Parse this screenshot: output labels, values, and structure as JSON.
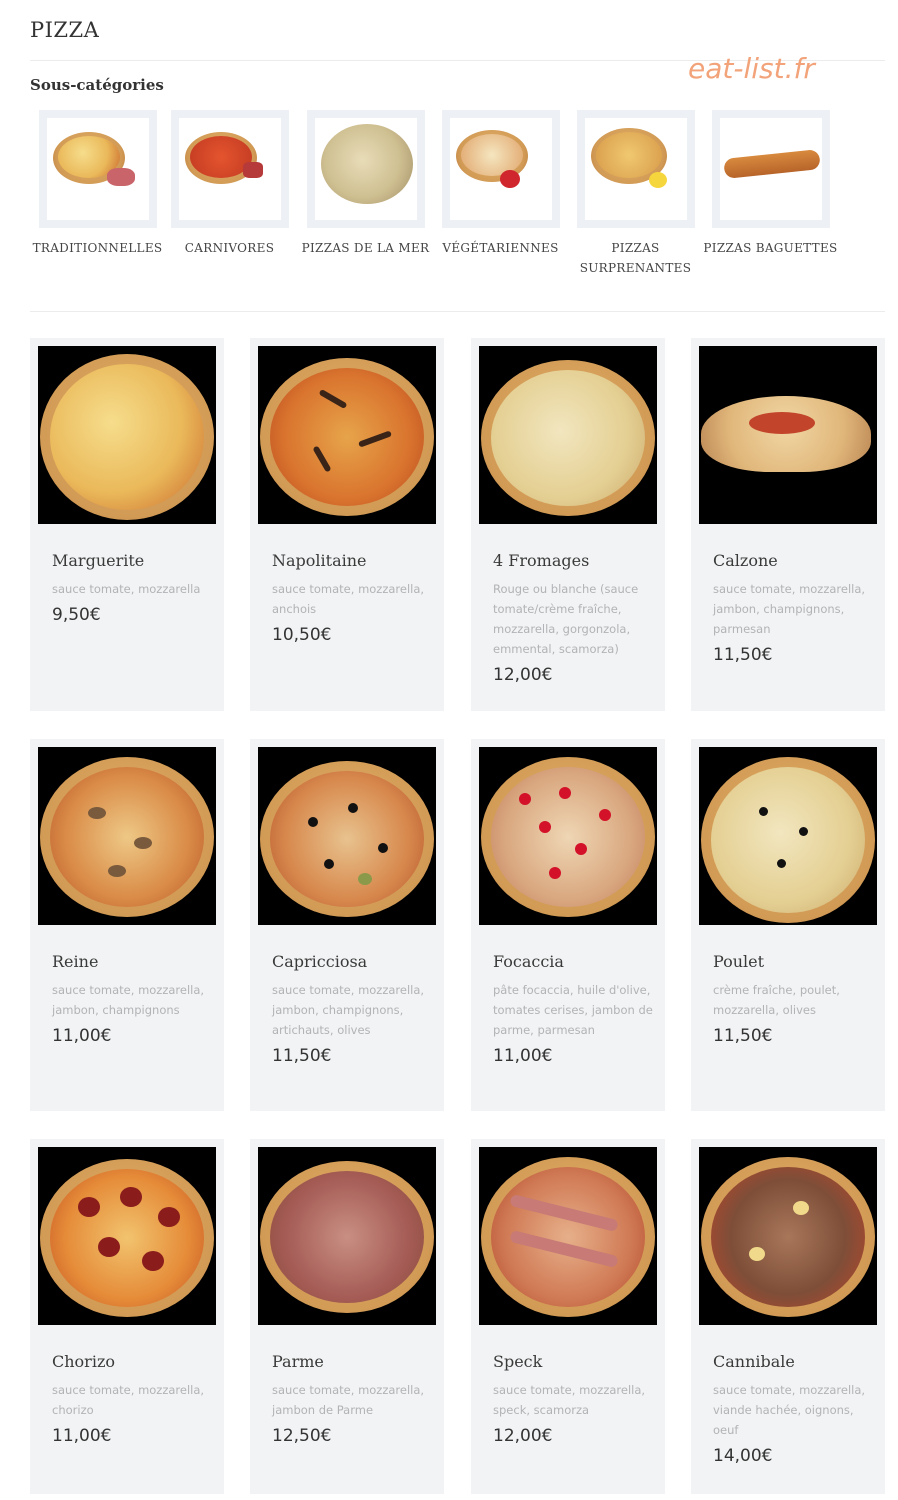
{
  "page": {
    "title": "PIZZA",
    "watermark": "eat-list.fr"
  },
  "subcategories": {
    "heading": "Sous-catégories",
    "items": [
      {
        "label": "TRADITIONNELLES"
      },
      {
        "label": "CARNIVORES"
      },
      {
        "label": "PIZZAS DE LA MER"
      },
      {
        "label": "VÉGÉTARIENNES"
      },
      {
        "label": "PIZZAS SURPRENANTES"
      },
      {
        "label": "PIZZAS BAGUETTES"
      }
    ]
  },
  "products": [
    {
      "name": "Marguerite",
      "desc": "sauce tomate, mozzarella",
      "price": "9,50€"
    },
    {
      "name": "Napolitaine",
      "desc": "sauce tomate, mozzarella, anchois",
      "price": "10,50€"
    },
    {
      "name": "4 Fromages",
      "desc": "Rouge ou blanche (sauce tomate/crème fraîche, mozzarella, gorgonzola, emmental, scamorza)",
      "price": "12,00€"
    },
    {
      "name": "Calzone",
      "desc": "sauce tomate, mozzarella, jambon, champignons, parmesan",
      "price": "11,50€"
    },
    {
      "name": "Reine",
      "desc": "sauce tomate, mozzarella, jambon, champignons",
      "price": "11,00€"
    },
    {
      "name": "Capricciosa",
      "desc": "sauce tomate, mozzarella, jambon, champignons, artichauts, olives",
      "price": "11,50€"
    },
    {
      "name": "Focaccia",
      "desc": "pâte focaccia, huile d'olive, tomates cerises, jambon de parme, parmesan",
      "price": "11,00€"
    },
    {
      "name": "Poulet",
      "desc": "crème fraîche, poulet, mozzarella, olives",
      "price": "11,50€"
    },
    {
      "name": "Chorizo",
      "desc": "sauce tomate, mozzarella, chorizo",
      "price": "11,00€"
    },
    {
      "name": "Parme",
      "desc": "sauce tomate, mozzarella, jambon de Parme",
      "price": "12,50€"
    },
    {
      "name": "Speck",
      "desc": "sauce tomate, mozzarella, speck, scamorza",
      "price": "12,00€"
    },
    {
      "name": "Cannibale",
      "desc": "sauce tomate, mozzarella, viande hachée, oignons, oeuf",
      "price": "14,00€"
    }
  ]
}
